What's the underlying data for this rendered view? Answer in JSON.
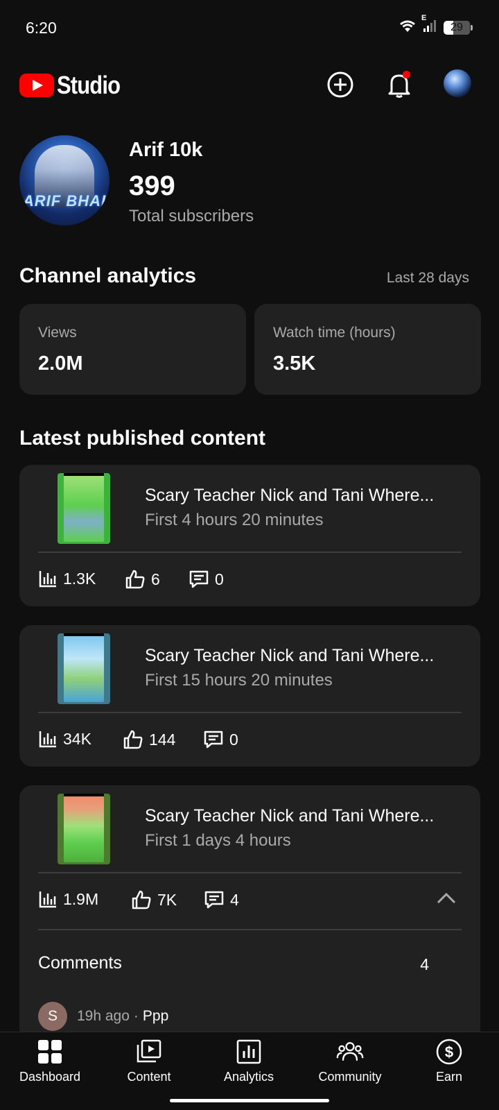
{
  "status_bar": {
    "time": "6:20",
    "battery": "29",
    "network": "E"
  },
  "app_bar": {
    "logo_text": "Studio",
    "icons": [
      "add-circle-icon",
      "bell-icon",
      "avatar"
    ]
  },
  "channel": {
    "name": "Arif 10k",
    "subscribers": "399",
    "subscribers_label": "Total subscribers",
    "avatar_text": "ARIF BHAI"
  },
  "analytics": {
    "title": "Channel analytics",
    "period": "Last 28 days",
    "cards": [
      {
        "label": "Views",
        "value": "2.0M"
      },
      {
        "label": "Watch time (hours)",
        "value": "3.5K"
      }
    ]
  },
  "latest": {
    "title": "Latest published content",
    "videos": [
      {
        "title": "Scary Teacher Nick and Tani Where...",
        "subtitle": "First 4 hours 20 minutes",
        "views": "1.3K",
        "likes": "6",
        "comments": "0",
        "thumb_color": "#3cb33c"
      },
      {
        "title": "Scary Teacher Nick and Tani Where...",
        "subtitle": "First 15 hours 20 minutes",
        "views": "34K",
        "likes": "144",
        "comments": "0",
        "thumb_color": "#4aa3d8"
      },
      {
        "title": "Scary Teacher Nick and Tani Where...",
        "subtitle": "First 1 days 4 hours",
        "views": "1.9M",
        "likes": "7K",
        "comments": "4",
        "thumb_color": "#4caf3c"
      }
    ],
    "comments_section": {
      "label": "Comments",
      "count": "4",
      "first_comment": {
        "initial": "S",
        "time": "19h ago",
        "separator": "·",
        "text": "Ppp"
      }
    }
  },
  "bottom_nav": [
    {
      "label": "Dashboard",
      "icon": "dashboard-icon"
    },
    {
      "label": "Content",
      "icon": "content-icon"
    },
    {
      "label": "Analytics",
      "icon": "analytics-icon"
    },
    {
      "label": "Community",
      "icon": "community-icon"
    },
    {
      "label": "Earn",
      "icon": "earn-icon"
    }
  ]
}
